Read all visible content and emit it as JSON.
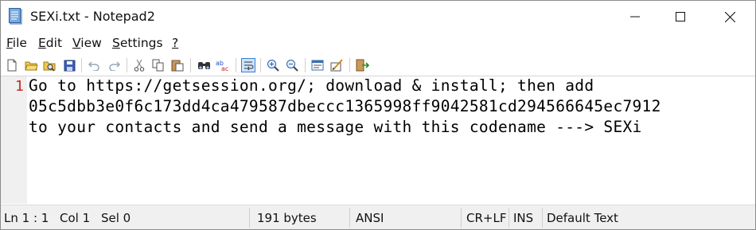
{
  "window": {
    "title": "SEXi.txt - Notepad2"
  },
  "menu": [
    {
      "label": "File",
      "key": "F",
      "rest": "ile"
    },
    {
      "label": "Edit",
      "key": "E",
      "rest": "dit"
    },
    {
      "label": "View",
      "key": "V",
      "rest": "iew"
    },
    {
      "label": "Settings",
      "key": "S",
      "rest": "ettings"
    },
    {
      "label": "?",
      "key": "?",
      "rest": ""
    }
  ],
  "toolbar": [
    "new-file-icon",
    "open-folder-icon",
    "browse-icon",
    "save-icon",
    "undo-icon",
    "redo-icon",
    "cut-icon",
    "copy-icon",
    "paste-icon",
    "find-icon",
    "replace-icon",
    "word-wrap-icon",
    "zoom-in-icon",
    "zoom-out-icon",
    "scheme-icon",
    "customize-scheme-icon",
    "exit-icon"
  ],
  "editor": {
    "line_number": "1",
    "lines": [
      "Go to https://getsession.org/; download & install; then add",
      "05c5dbb3e0f6c173dd4ca479587dbeccc1365998ff9042581cd294566645ec7912",
      "to your contacts and send a message with this codename ---> SEXi"
    ]
  },
  "status": {
    "position": "Ln 1 : 1",
    "column": "Col 1",
    "selection": "Sel 0",
    "size": "191 bytes",
    "encoding": "ANSI",
    "line_endings": "CR+LF",
    "mode": "INS",
    "scheme": "Default Text"
  },
  "colors": {
    "line_number": "#c8281e",
    "status_bg": "#f0f0f0",
    "gutter_bg": "#f0f0f0",
    "active_tool_border": "#3b7fd0"
  }
}
